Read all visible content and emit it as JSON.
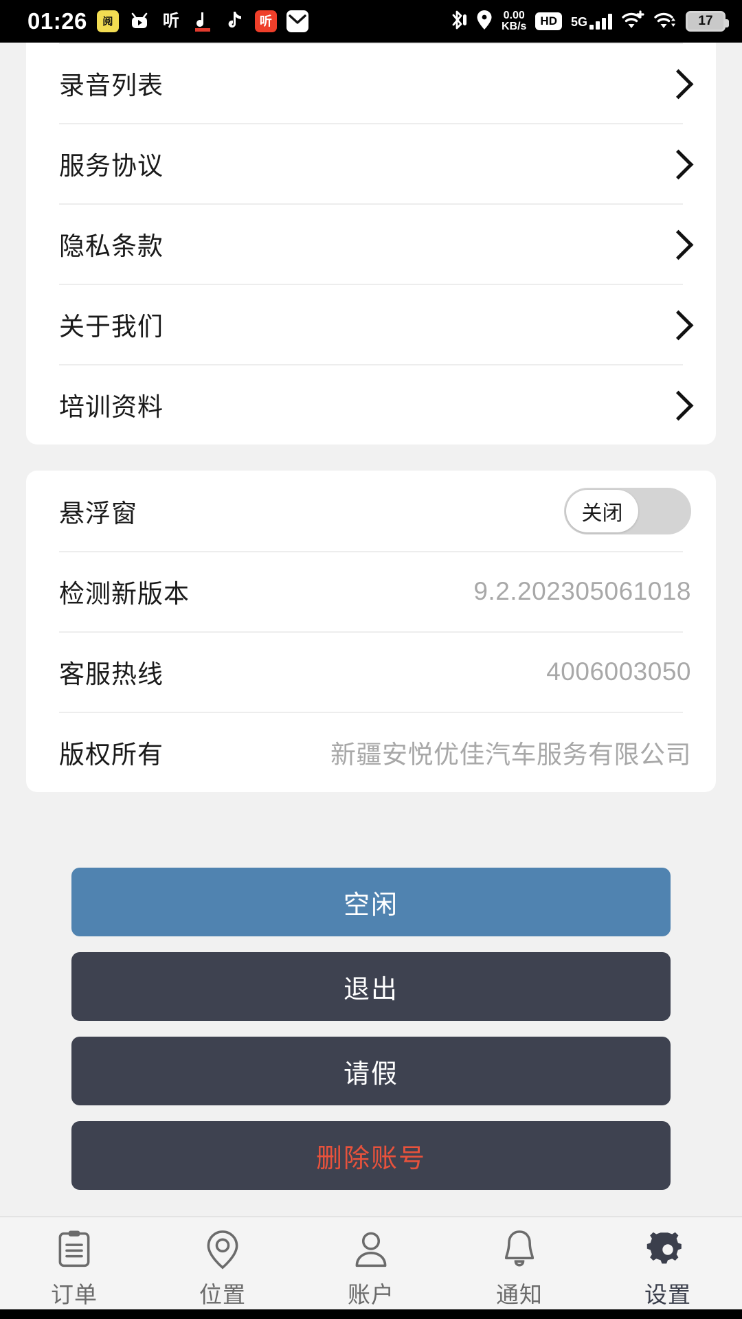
{
  "statusbar": {
    "time": "01:26",
    "left_app_icons": [
      {
        "name": "news-app-icon",
        "glyph": "阅读"
      },
      {
        "name": "bilibili-app-icon",
        "glyph": "⏵"
      },
      {
        "name": "listen-app-icon",
        "glyph": "听"
      },
      {
        "name": "xiaohongshu-music-icon",
        "glyph": "♪"
      },
      {
        "name": "tiktok-app-icon",
        "glyph": "♪"
      },
      {
        "name": "ting-app-icon",
        "glyph": "听"
      },
      {
        "name": "mail-app-icon",
        "glyph": "✉"
      }
    ],
    "bluetooth": "bluetooth-icon",
    "location": "location-icon",
    "net_speed_value": "0.00",
    "net_speed_unit": "KB/s",
    "hd_label": "HD",
    "network_type": "5G",
    "wifi_primary": "wifi-plus-icon",
    "wifi_secondary": "wifi-sync-icon",
    "battery_percent": "17"
  },
  "menu_card": {
    "items": [
      {
        "label": "录音列表",
        "accessory": "chevron-right-icon"
      },
      {
        "label": "服务协议",
        "accessory": "chevron-right-icon"
      },
      {
        "label": "隐私条款",
        "accessory": "chevron-right-icon"
      },
      {
        "label": "关于我们",
        "accessory": "chevron-right-icon"
      },
      {
        "label": "培训资料",
        "accessory": "chevron-right-icon"
      }
    ]
  },
  "info_card": {
    "floating_window": {
      "label": "悬浮窗",
      "toggle_state_text": "关闭",
      "toggle_on": false
    },
    "rows": [
      {
        "label": "检测新版本",
        "value": "9.2.202305061018"
      },
      {
        "label": "客服热线",
        "value": "4006003050"
      },
      {
        "label": "版权所有",
        "value": "新疆安悦优佳汽车服务有限公司"
      }
    ]
  },
  "actions": [
    {
      "label": "空闲",
      "style": "blue"
    },
    {
      "label": "退出",
      "style": "dark"
    },
    {
      "label": "请假",
      "style": "dark"
    },
    {
      "label": "删除账号",
      "style": "dark-danger"
    }
  ],
  "tabbar": {
    "items": [
      {
        "label": "订单",
        "icon": "clipboard-icon",
        "active": false
      },
      {
        "label": "位置",
        "icon": "location-pin-icon",
        "active": false
      },
      {
        "label": "账户",
        "icon": "user-icon",
        "active": false
      },
      {
        "label": "通知",
        "icon": "bell-icon",
        "active": false
      },
      {
        "label": "设置",
        "icon": "gear-icon",
        "active": true
      }
    ]
  },
  "colors": {
    "page_background": "#f1f1f1",
    "card_background": "#ffffff",
    "accent_blue": "#5083b0",
    "dark_button": "#3e4250",
    "danger_red": "#e8523c",
    "value_gray": "#a8a8a8"
  }
}
